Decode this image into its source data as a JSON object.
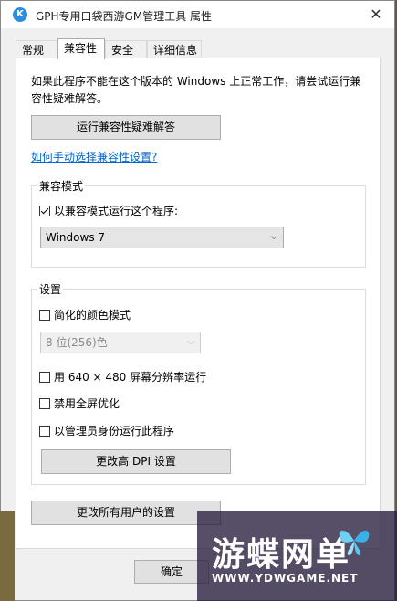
{
  "window": {
    "app_icon_letter": "K",
    "title": "GPH专用口袋西游GM管理工具 属性",
    "close_glyph": "✕"
  },
  "tabs": [
    {
      "label": "常规"
    },
    {
      "label": "兼容性"
    },
    {
      "label": "安全"
    },
    {
      "label": "详细信息"
    }
  ],
  "compat": {
    "description": "如果此程序不能在这个版本的 Windows 上正常工作，请尝试运行兼容性疑难解答。",
    "troubleshoot_button": "运行兼容性疑难解答",
    "manual_link": "如何手动选择兼容性设置?",
    "mode_group": {
      "legend": "兼容模式",
      "run_in_mode_label": "以兼容模式运行这个程序:",
      "run_in_mode_checked": true,
      "os_selected": "Windows 7"
    },
    "settings_group": {
      "legend": "设置",
      "reduced_color_label": "简化的颜色模式",
      "color_depth_selected": "8 位(256)色",
      "run_640_label": "用 640 × 480 屏幕分辨率运行",
      "disable_fullscreen_label": "禁用全屏优化",
      "run_as_admin_label": "以管理员身份运行此程序",
      "dpi_button": "更改高 DPI 设置"
    },
    "all_users_button": "更改所有用户的设置"
  },
  "footer": {
    "ok_button": "确定"
  },
  "watermark": {
    "title": "游蝶网单",
    "url": "WWW.YDWGAME.NET"
  }
}
